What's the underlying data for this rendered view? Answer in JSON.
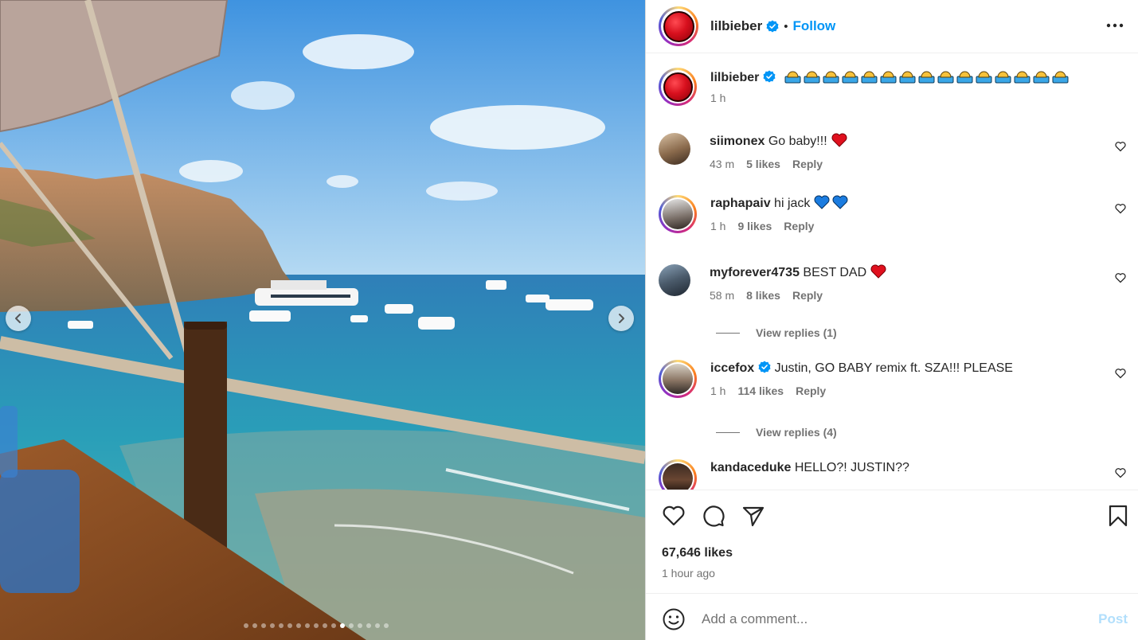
{
  "post": {
    "author": "lilbieber",
    "author_verified": true,
    "follow_label": "Follow",
    "separator": "•",
    "caption_emoji_count": 15,
    "caption_emoji": "person-bald-emoji",
    "caption_time": "1 h",
    "likes": "67,646 likes",
    "posted_ago": "1 hour ago"
  },
  "carousel": {
    "slide_count": 17,
    "active_slide": 11
  },
  "comments": [
    {
      "user": "siimonex",
      "verified": false,
      "text": "Go baby!!!",
      "emoji": "red-heart",
      "time": "43 m",
      "likes": "5 likes",
      "reply": "Reply"
    },
    {
      "user": "raphapaiv",
      "verified": false,
      "text": "hi jack",
      "emoji": "blue-heart x2",
      "time": "1 h",
      "likes": "9 likes",
      "reply": "Reply"
    },
    {
      "user": "myforever4735",
      "verified": false,
      "text": "BEST DAD",
      "emoji": "red-heart",
      "time": "58 m",
      "likes": "8 likes",
      "reply": "Reply",
      "view_replies": "View replies (1)"
    },
    {
      "user": "iccefox",
      "verified": true,
      "text": "Justin, GO BABY remix ft. SZA!!! PLEASE",
      "time": "1 h",
      "likes": "114 likes",
      "reply": "Reply",
      "view_replies": "View replies (4)"
    },
    {
      "user": "kandaceduke",
      "verified": false,
      "text": "HELLO?! JUSTIN??"
    }
  ],
  "composer": {
    "placeholder": "Add a comment...",
    "post_label": "Post"
  },
  "colors": {
    "link_blue": "#0095f6",
    "post_disabled": "#b2dffc",
    "verified_blue": "#0095f6",
    "secondary_text": "#737373"
  }
}
